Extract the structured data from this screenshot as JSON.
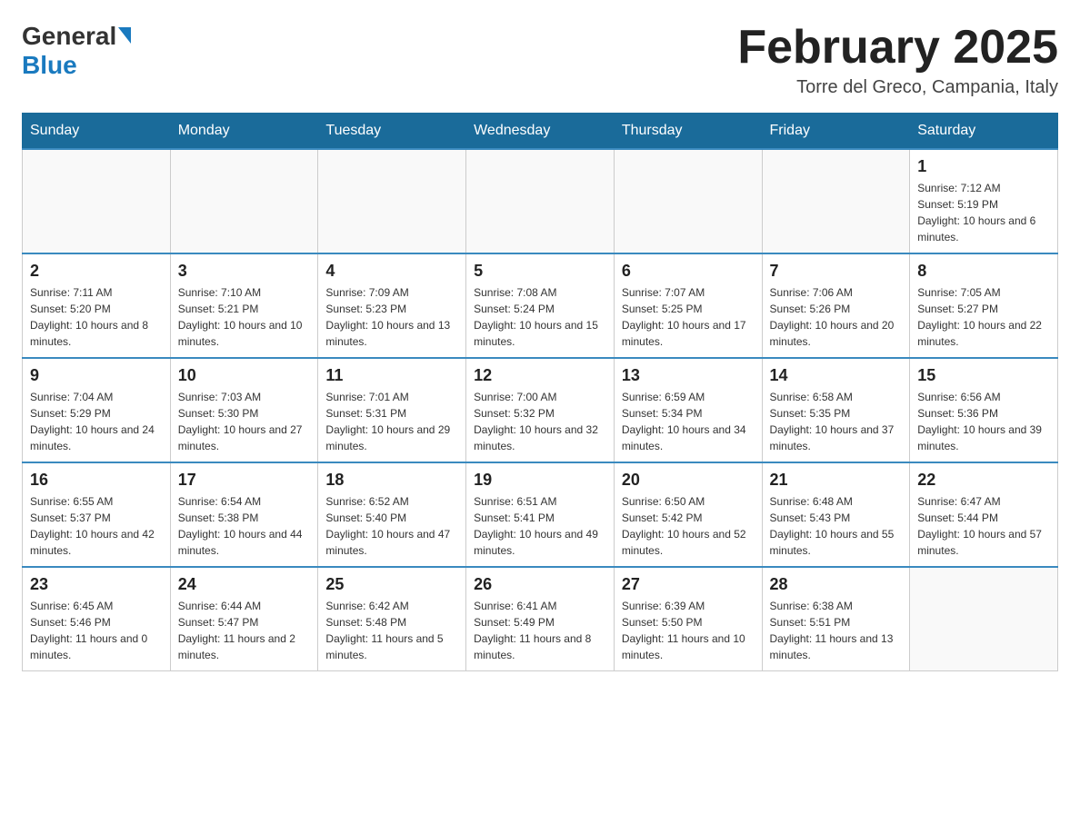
{
  "header": {
    "logo": {
      "general": "General",
      "blue": "Blue"
    },
    "title": "February 2025",
    "subtitle": "Torre del Greco, Campania, Italy"
  },
  "days_of_week": [
    "Sunday",
    "Monday",
    "Tuesday",
    "Wednesday",
    "Thursday",
    "Friday",
    "Saturday"
  ],
  "weeks": [
    [
      {
        "day": "",
        "info": ""
      },
      {
        "day": "",
        "info": ""
      },
      {
        "day": "",
        "info": ""
      },
      {
        "day": "",
        "info": ""
      },
      {
        "day": "",
        "info": ""
      },
      {
        "day": "",
        "info": ""
      },
      {
        "day": "1",
        "info": "Sunrise: 7:12 AM\nSunset: 5:19 PM\nDaylight: 10 hours and 6 minutes."
      }
    ],
    [
      {
        "day": "2",
        "info": "Sunrise: 7:11 AM\nSunset: 5:20 PM\nDaylight: 10 hours and 8 minutes."
      },
      {
        "day": "3",
        "info": "Sunrise: 7:10 AM\nSunset: 5:21 PM\nDaylight: 10 hours and 10 minutes."
      },
      {
        "day": "4",
        "info": "Sunrise: 7:09 AM\nSunset: 5:23 PM\nDaylight: 10 hours and 13 minutes."
      },
      {
        "day": "5",
        "info": "Sunrise: 7:08 AM\nSunset: 5:24 PM\nDaylight: 10 hours and 15 minutes."
      },
      {
        "day": "6",
        "info": "Sunrise: 7:07 AM\nSunset: 5:25 PM\nDaylight: 10 hours and 17 minutes."
      },
      {
        "day": "7",
        "info": "Sunrise: 7:06 AM\nSunset: 5:26 PM\nDaylight: 10 hours and 20 minutes."
      },
      {
        "day": "8",
        "info": "Sunrise: 7:05 AM\nSunset: 5:27 PM\nDaylight: 10 hours and 22 minutes."
      }
    ],
    [
      {
        "day": "9",
        "info": "Sunrise: 7:04 AM\nSunset: 5:29 PM\nDaylight: 10 hours and 24 minutes."
      },
      {
        "day": "10",
        "info": "Sunrise: 7:03 AM\nSunset: 5:30 PM\nDaylight: 10 hours and 27 minutes."
      },
      {
        "day": "11",
        "info": "Sunrise: 7:01 AM\nSunset: 5:31 PM\nDaylight: 10 hours and 29 minutes."
      },
      {
        "day": "12",
        "info": "Sunrise: 7:00 AM\nSunset: 5:32 PM\nDaylight: 10 hours and 32 minutes."
      },
      {
        "day": "13",
        "info": "Sunrise: 6:59 AM\nSunset: 5:34 PM\nDaylight: 10 hours and 34 minutes."
      },
      {
        "day": "14",
        "info": "Sunrise: 6:58 AM\nSunset: 5:35 PM\nDaylight: 10 hours and 37 minutes."
      },
      {
        "day": "15",
        "info": "Sunrise: 6:56 AM\nSunset: 5:36 PM\nDaylight: 10 hours and 39 minutes."
      }
    ],
    [
      {
        "day": "16",
        "info": "Sunrise: 6:55 AM\nSunset: 5:37 PM\nDaylight: 10 hours and 42 minutes."
      },
      {
        "day": "17",
        "info": "Sunrise: 6:54 AM\nSunset: 5:38 PM\nDaylight: 10 hours and 44 minutes."
      },
      {
        "day": "18",
        "info": "Sunrise: 6:52 AM\nSunset: 5:40 PM\nDaylight: 10 hours and 47 minutes."
      },
      {
        "day": "19",
        "info": "Sunrise: 6:51 AM\nSunset: 5:41 PM\nDaylight: 10 hours and 49 minutes."
      },
      {
        "day": "20",
        "info": "Sunrise: 6:50 AM\nSunset: 5:42 PM\nDaylight: 10 hours and 52 minutes."
      },
      {
        "day": "21",
        "info": "Sunrise: 6:48 AM\nSunset: 5:43 PM\nDaylight: 10 hours and 55 minutes."
      },
      {
        "day": "22",
        "info": "Sunrise: 6:47 AM\nSunset: 5:44 PM\nDaylight: 10 hours and 57 minutes."
      }
    ],
    [
      {
        "day": "23",
        "info": "Sunrise: 6:45 AM\nSunset: 5:46 PM\nDaylight: 11 hours and 0 minutes."
      },
      {
        "day": "24",
        "info": "Sunrise: 6:44 AM\nSunset: 5:47 PM\nDaylight: 11 hours and 2 minutes."
      },
      {
        "day": "25",
        "info": "Sunrise: 6:42 AM\nSunset: 5:48 PM\nDaylight: 11 hours and 5 minutes."
      },
      {
        "day": "26",
        "info": "Sunrise: 6:41 AM\nSunset: 5:49 PM\nDaylight: 11 hours and 8 minutes."
      },
      {
        "day": "27",
        "info": "Sunrise: 6:39 AM\nSunset: 5:50 PM\nDaylight: 11 hours and 10 minutes."
      },
      {
        "day": "28",
        "info": "Sunrise: 6:38 AM\nSunset: 5:51 PM\nDaylight: 11 hours and 13 minutes."
      },
      {
        "day": "",
        "info": ""
      }
    ]
  ]
}
